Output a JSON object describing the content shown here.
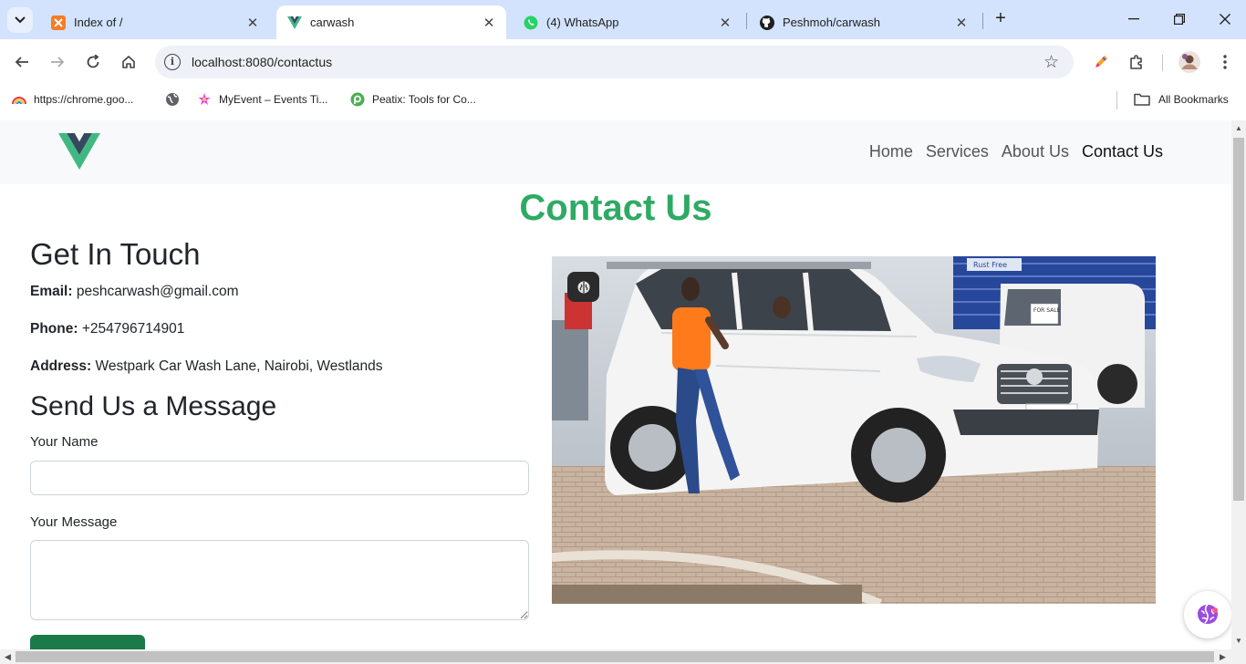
{
  "browser": {
    "tabs": [
      {
        "title": "Index of /",
        "icon": "xampp-icon"
      },
      {
        "title": "carwash",
        "icon": "vue-icon"
      },
      {
        "title": "(4) WhatsApp",
        "icon": "whatsapp-icon"
      },
      {
        "title": "Peshmoh/carwash",
        "icon": "github-icon"
      }
    ],
    "active_tab": 1,
    "url": "localhost:8080/contactus",
    "bookmarks": [
      {
        "label": "https://chrome.goo...",
        "icon": "rainbow-icon"
      },
      {
        "label": "",
        "icon": "globe-icon"
      },
      {
        "label": "MyEvent – Events Ti...",
        "icon": "myevent-icon"
      },
      {
        "label": "Peatix: Tools for Co...",
        "icon": "peatix-icon"
      }
    ],
    "all_bookmarks_label": "All Bookmarks"
  },
  "site": {
    "nav": {
      "links": [
        "Home",
        "Services",
        "About Us",
        "Contact Us"
      ],
      "active": "Contact Us"
    },
    "page_title": "Contact Us",
    "contact": {
      "heading": "Get In Touch",
      "email_label": "Email:",
      "email": "peshcarwash@gmail.com",
      "phone_label": "Phone:",
      "phone": "+254796714901",
      "address_label": "Address:",
      "address": "Westpark Car Wash Lane, Nairobi, Westlands"
    },
    "form": {
      "heading": "Send Us a Message",
      "name_label": "Your Name",
      "name_value": "",
      "message_label": "Your Message",
      "message_value": ""
    },
    "photo": {
      "sign_text": "Rust Free",
      "sale_text": "FOR SALE"
    }
  },
  "colors": {
    "title_green": "#2eaa64",
    "button_green": "#1b7a4a",
    "vue_green": "#41b883",
    "vue_dark": "#35495e"
  }
}
